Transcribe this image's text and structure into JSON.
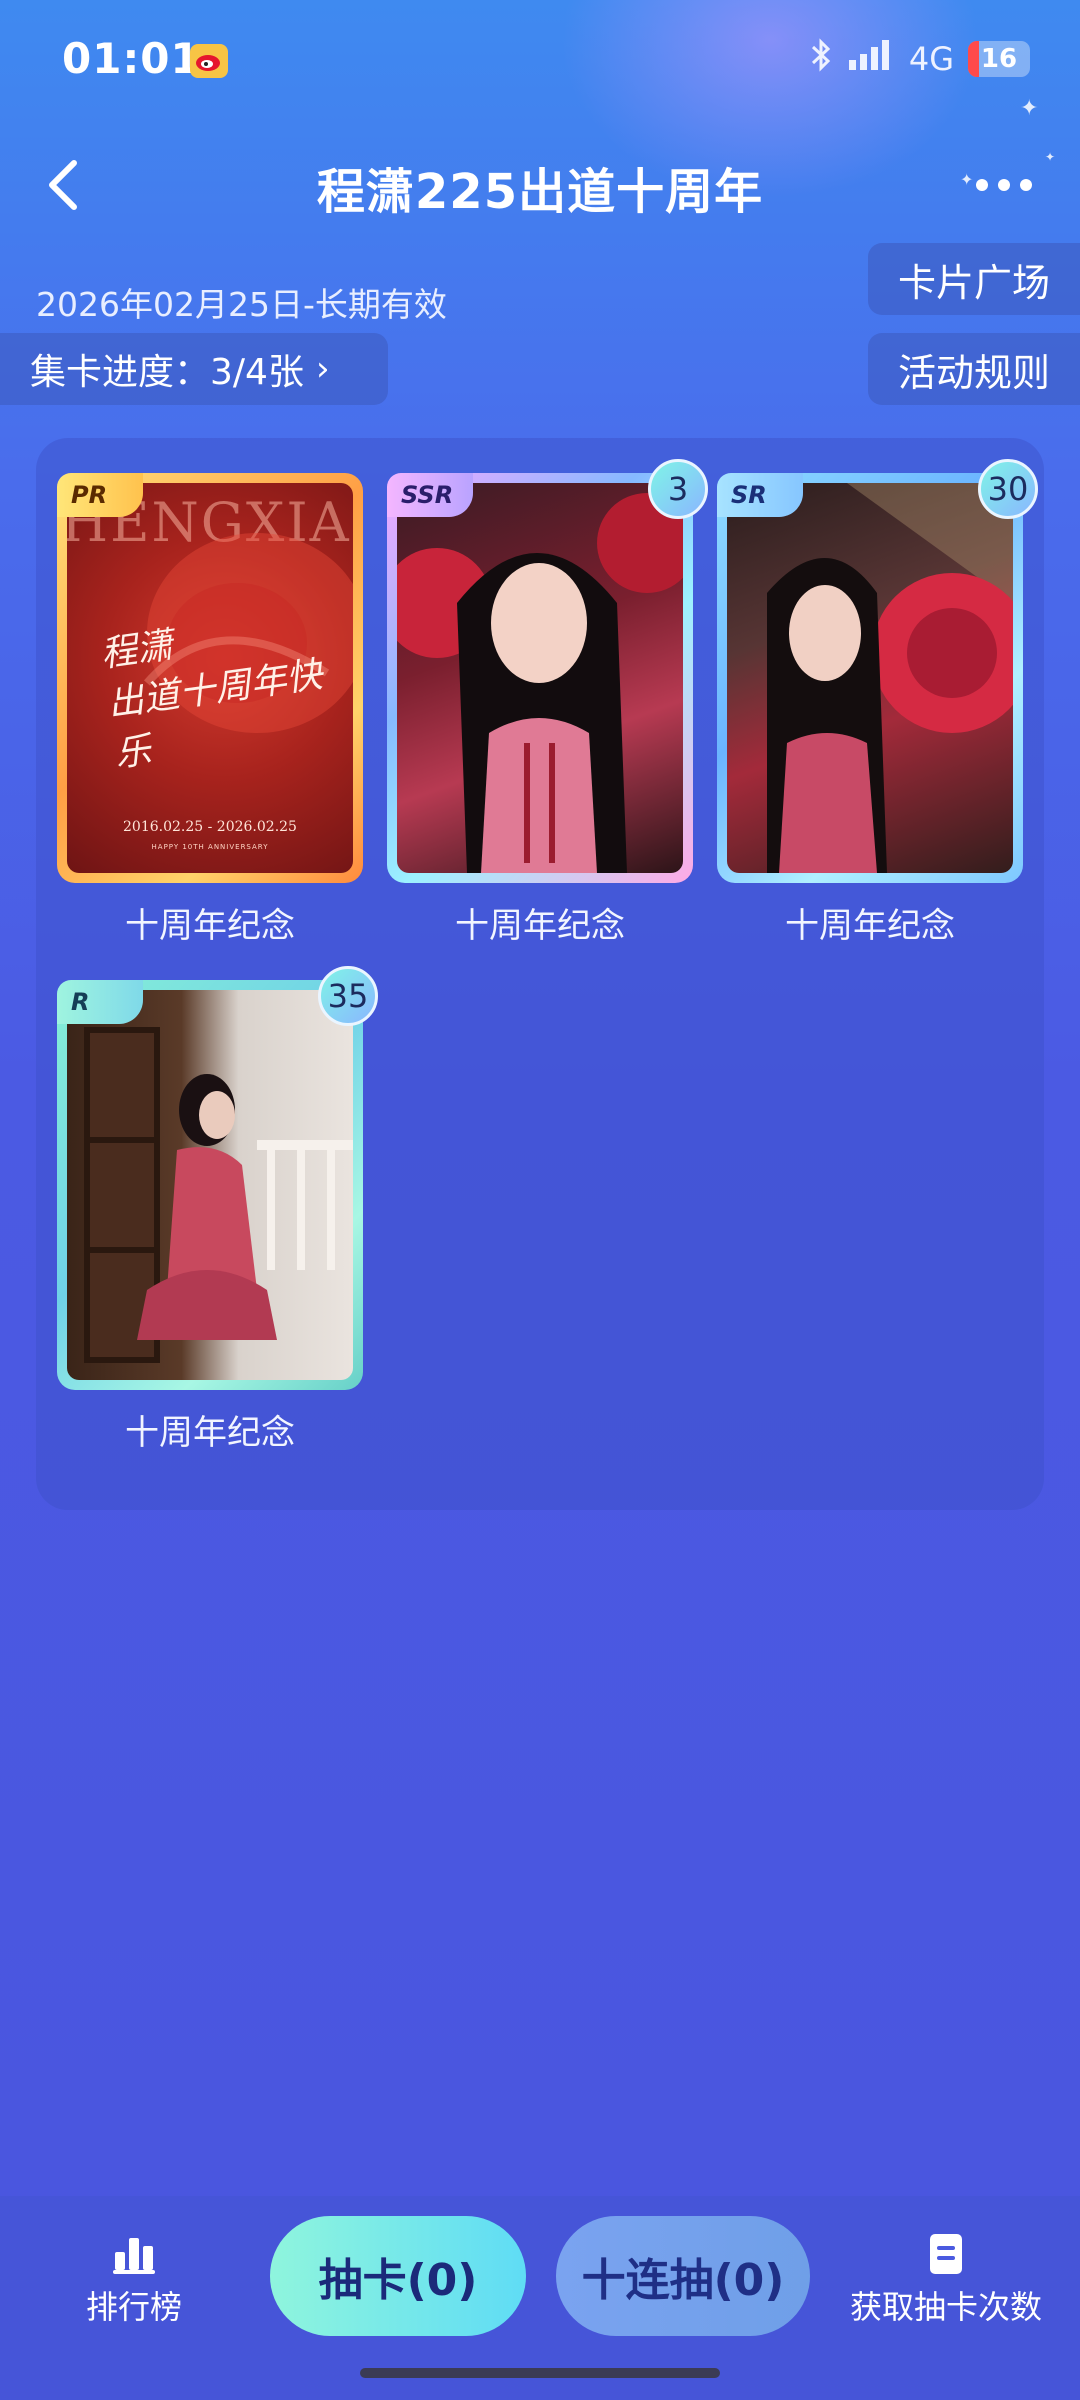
{
  "status_bar": {
    "time": "01:01",
    "app_icon": "weibo-icon",
    "bluetooth_icon": "bluetooth-icon",
    "signal_icon": "signal-icon",
    "network": "4G",
    "battery": "16",
    "battery_level": 0.16
  },
  "header": {
    "back_icon": "chevron-left-icon",
    "title": "程潇225出道十周年",
    "more_icon": "more-horizontal-icon"
  },
  "info": {
    "date_range": "2026年02月25日-长期有效",
    "progress_label": "集卡进度：3/4张",
    "progress_chevron": "›",
    "card_plaza": "卡片广场",
    "activity_rules": "活动规则"
  },
  "cards": [
    {
      "rarity": "PR",
      "count": null,
      "caption": "十周年纪念",
      "art_brand": "HENGXIAO",
      "art_script": "程潇\n出道十周年快乐",
      "art_dates": "2016.02.25 - 2026.02.25",
      "art_small": "HAPPY 10TH ANNIVERSARY"
    },
    {
      "rarity": "SSR",
      "count": "3",
      "caption": "十周年纪念"
    },
    {
      "rarity": "SR",
      "count": "30",
      "caption": "十周年纪念"
    },
    {
      "rarity": "R",
      "count": "35",
      "caption": "十周年纪念"
    }
  ],
  "bottom": {
    "leaderboard": "排行榜",
    "leaderboard_icon": "bar-chart-icon",
    "draw_one": "抽卡(0)",
    "draw_ten": "十连抽(0)",
    "get_draws": "获取抽卡次数",
    "get_draws_icon": "document-icon"
  },
  "colors": {
    "background_top": "#3f8af0",
    "background_bottom": "#4a55de",
    "draw_button": "#5fdcf5",
    "battery_low": "#ff4a4a"
  }
}
